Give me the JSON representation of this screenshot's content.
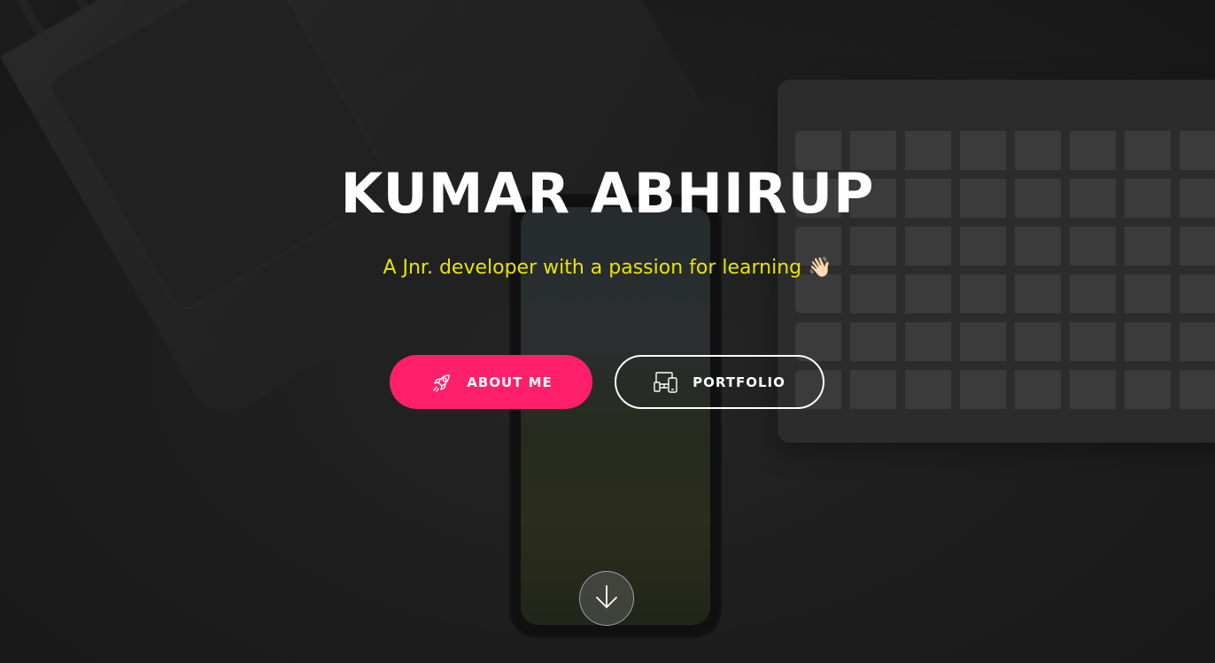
{
  "hero": {
    "name": "KUMAR ABHIRUP",
    "tagline": "A Jnr. developer with a passion for learning",
    "tagline_emoji": "👋🏻"
  },
  "buttons": {
    "about_label": "ABOUT ME",
    "portfolio_label": "PORTFOLIO"
  },
  "icons": {
    "about": "rocket-icon",
    "portfolio": "devices-icon",
    "scroll": "arrow-down-icon"
  },
  "colors": {
    "accent": "#ff1f6b",
    "tagline": "#e6e600",
    "title": "#ffffff"
  }
}
